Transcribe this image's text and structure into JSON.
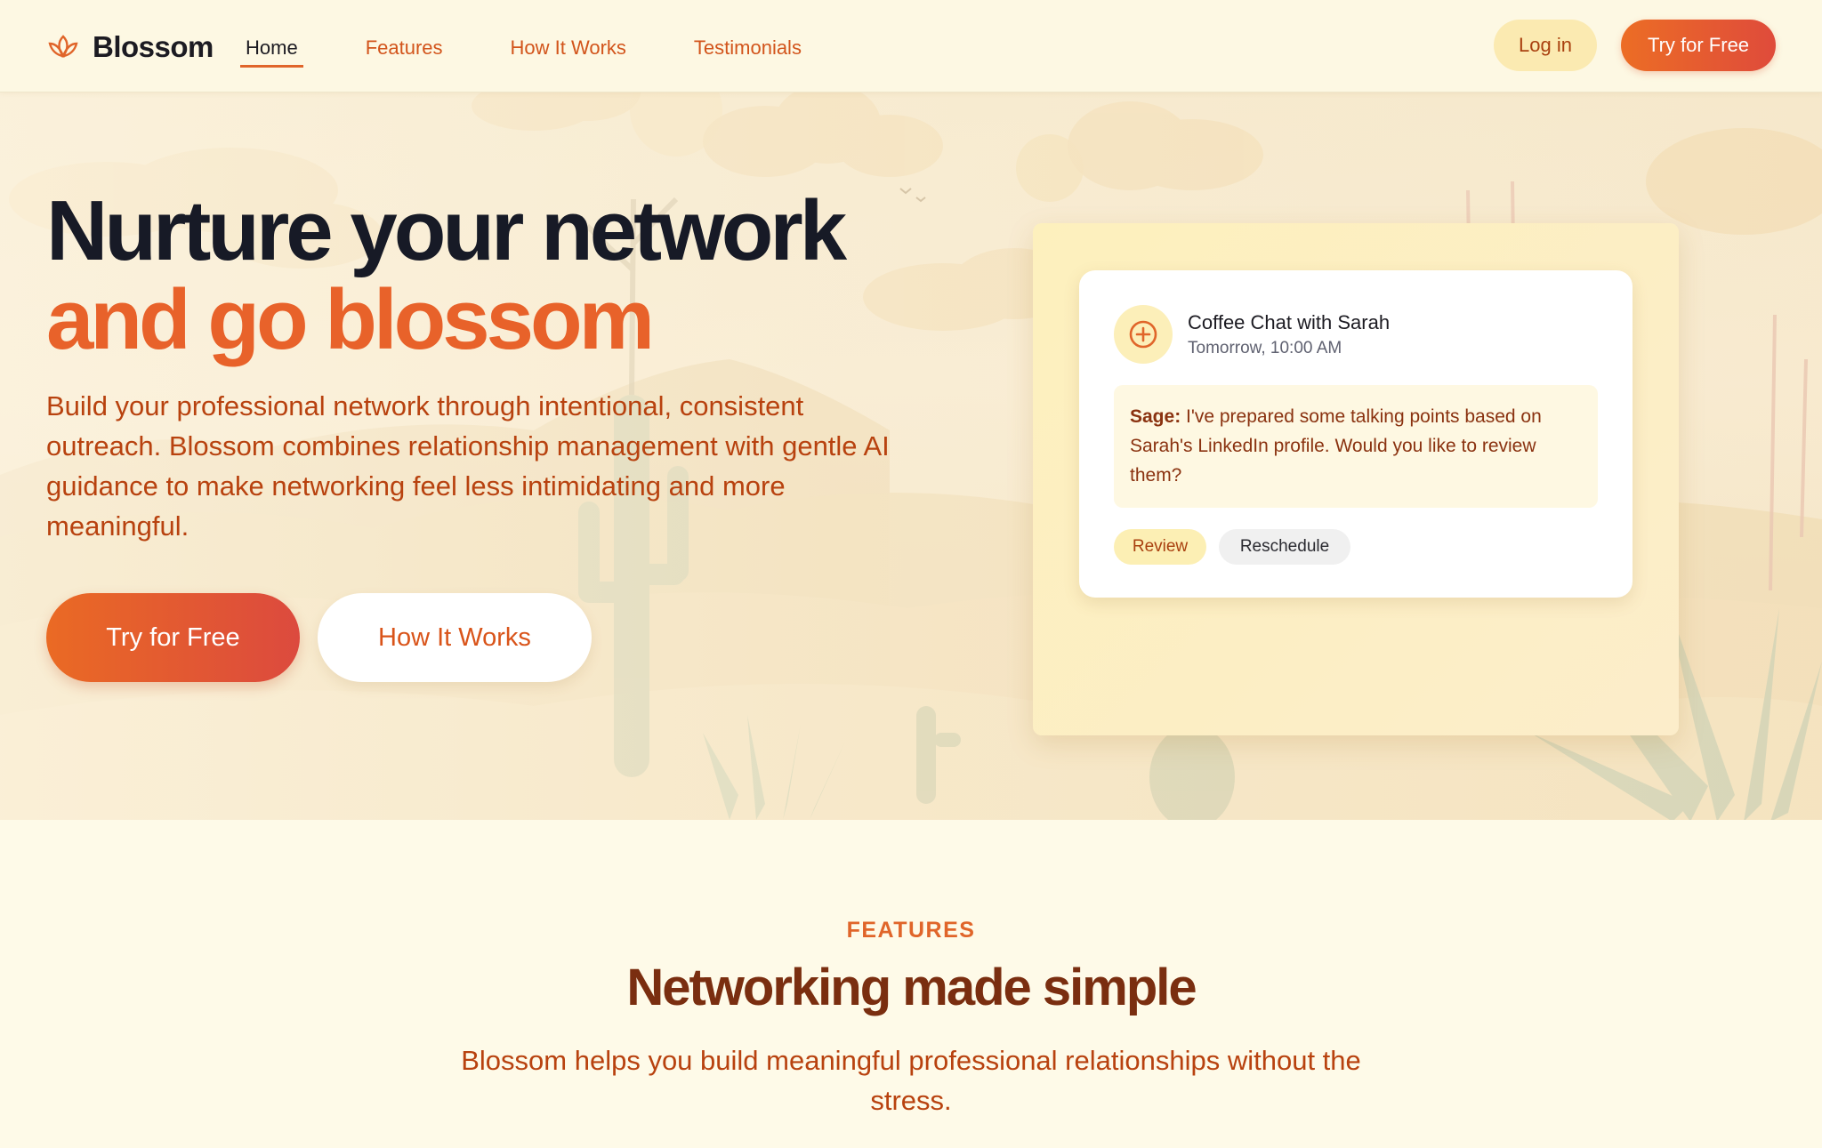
{
  "header": {
    "brand": "Blossom",
    "nav": [
      "Home",
      "Features",
      "How It Works",
      "Testimonials"
    ],
    "active_nav": "Home",
    "login_label": "Log in",
    "cta_label": "Try for Free"
  },
  "hero": {
    "title_line1": "Nurture your network",
    "title_line2": "and go blossom",
    "description": "Build your professional network through intentional, consistent outreach. Blossom combines relationship management with gentle AI guidance to make networking feel less intimidating and more meaningful.",
    "primary_cta": "Try for Free",
    "secondary_cta": "How It Works"
  },
  "card": {
    "icon": "plus-circle-icon",
    "title": "Coffee Chat with Sarah",
    "subtitle": "Tomorrow, 10:00 AM",
    "message_author": "Sage:",
    "message_text": " I've prepared some talking points based on Sarah's LinkedIn profile. Would you like to review them?",
    "action_primary": "Review",
    "action_secondary": "Reschedule"
  },
  "features": {
    "eyebrow": "FEATURES",
    "title": "Networking made simple",
    "description": "Blossom helps you build meaningful professional relationships without the stress."
  },
  "colors": {
    "accent": "#e8622a",
    "accent_dark": "#b8420f",
    "heading_dark": "#171a26",
    "background": "#fefae8"
  }
}
